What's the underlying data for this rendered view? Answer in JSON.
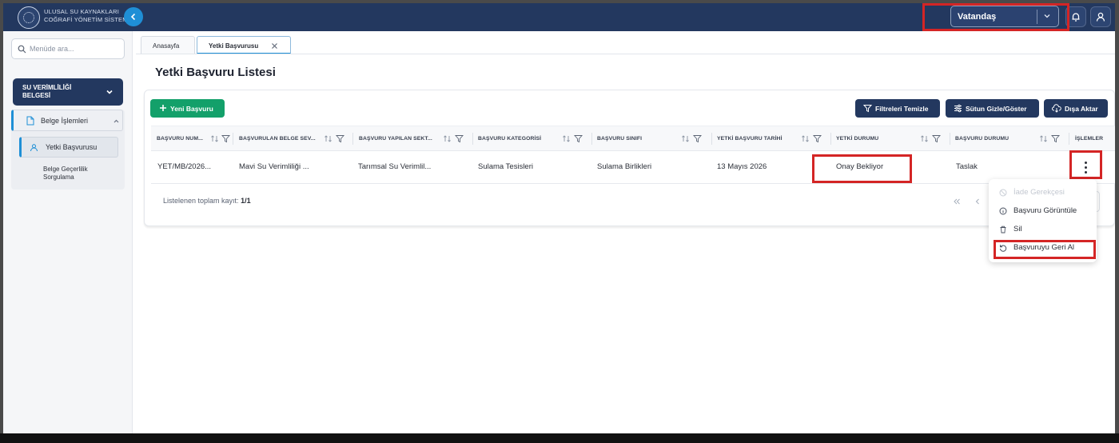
{
  "header": {
    "brand_line1": "ULUSAL SU KAYNAKLARI",
    "brand_line2": "COĞRAFİ YÖNETİM SİSTEMİ",
    "role_value": "Vatandaş"
  },
  "sidebar": {
    "search_placeholder": "Menüde ara...",
    "module_line1": "SU VERİMLİLİĞİ",
    "module_line2": "BELGESİ",
    "group_label": "Belge İşlemleri",
    "items": [
      {
        "label": "Yetki Başvurusu"
      },
      {
        "label_line1": "Belge Geçerlilik",
        "label_line2": "Sorgulama"
      }
    ]
  },
  "tabs": [
    {
      "label": "Anasayfa"
    },
    {
      "label": "Yetki Başvurusu"
    }
  ],
  "page_title": "Yetki Başvuru Listesi",
  "toolbar": {
    "new_label": "Yeni Başvuru",
    "clear_filters_label": "Filtreleri Temizle",
    "columns_label": "Sütun Gizle/Göster",
    "export_label": "Dışa Aktar"
  },
  "table": {
    "columns": [
      "BAŞVURU NUM...",
      "BAŞVURULAN BELGE SEV...",
      "BAŞVURU YAPILAN SEKT...",
      "BAŞVURU KATEGORİSİ",
      "BAŞVURU SINIFI",
      "YETKİ BAŞVURU TARİHİ",
      "YETKİ DURUMU",
      "BAŞVURU DURUMU",
      "İŞLEMLER"
    ],
    "rows": [
      [
        "YET/MB/2026...",
        "Mavi Su Verimliliği ...",
        "Tarımsal Su Verimlil...",
        "Sulama Tesisleri",
        "Sulama Birlikleri",
        "13 Mayıs 2026",
        "Onay Bekliyor",
        "Taslak"
      ]
    ],
    "footer_label": "Listelenen toplam kayıt:",
    "footer_count": "1/1"
  },
  "actions_menu": {
    "items": [
      {
        "label": "İade Gerekçesi",
        "disabled": true
      },
      {
        "label": "Başvuru Görüntüle",
        "disabled": false
      },
      {
        "label": "Sil",
        "disabled": false
      },
      {
        "label": "Başvuruyu Geri Al",
        "disabled": false
      }
    ]
  },
  "colors": {
    "navy": "#23385f",
    "accent_blue": "#1f8fd6",
    "green": "#13a06a",
    "highlight_red": "#d42525"
  }
}
